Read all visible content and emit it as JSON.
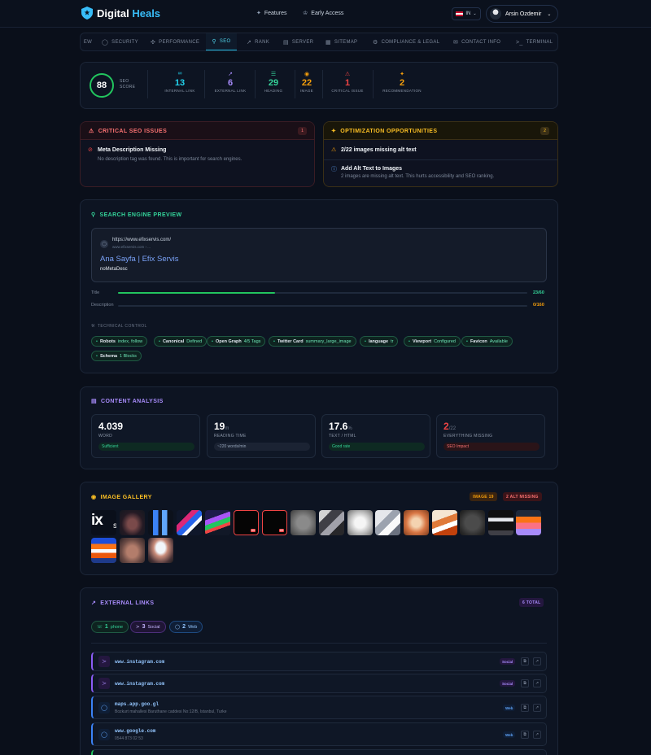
{
  "brand": {
    "name_a": "Digital ",
    "name_b": "Heals"
  },
  "nav": {
    "features": "Features",
    "early_access": "Early Access"
  },
  "lang": "IN",
  "user": {
    "name": "Arsin Ozdemir"
  },
  "tabs": [
    {
      "label": "EW",
      "icon": "overview-icon"
    },
    {
      "label": "SECURITY",
      "icon": "shield-icon"
    },
    {
      "label": "PERFORMANCE",
      "icon": "gauge-icon"
    },
    {
      "label": "SEO",
      "icon": "search-icon"
    },
    {
      "label": "RANK",
      "icon": "chart-icon"
    },
    {
      "label": "SERVER",
      "icon": "server-icon"
    },
    {
      "label": "SITEMAP",
      "icon": "sitemap-icon"
    },
    {
      "label": "COMPLIANCE & LEGAL",
      "icon": "scale-icon"
    },
    {
      "label": "CONTACT INFO",
      "icon": "mail-icon"
    },
    {
      "label": "TERMINAL",
      "icon": "terminal-icon"
    }
  ],
  "score": {
    "value": "88",
    "label_a": "SEO",
    "label_b": "SCORE",
    "color": "#22c55e"
  },
  "stats": [
    {
      "value": "13",
      "label": "INTERNAL LINK",
      "color": "#22d3ee",
      "icon": "link-icon"
    },
    {
      "value": "6",
      "label": "EXTERNAL LINK",
      "color": "#a78bfa",
      "icon": "external-link-icon"
    },
    {
      "value": "29",
      "label": "HEADING",
      "color": "#34d399",
      "icon": "layers-icon"
    },
    {
      "value": "22",
      "label": "IMAGE",
      "color": "#f59e0b",
      "icon": "eye-icon"
    },
    {
      "value": "1",
      "label": "CRITICAL ISSUE",
      "color": "#ef4444",
      "icon": "alert-icon"
    },
    {
      "value": "2",
      "label": "RECOMMENDATION",
      "color": "#f59e0b",
      "icon": "bolt-icon"
    }
  ],
  "critical": {
    "title": "CRITICAL SEO ISSUES",
    "count": "1",
    "items": [
      {
        "title": "Meta Description Missing",
        "desc": "No description tag was found. This is important for search engines."
      }
    ]
  },
  "opportunities": {
    "title": "OPTIMIZATION OPPORTUNITIES",
    "count": "2",
    "items": [
      {
        "title": "2/22 images missing alt text",
        "desc": ""
      },
      {
        "title": "Add Alt Text to Images",
        "desc": "2 images are missing alt text. This hurts accessibility and SEO ranking."
      }
    ]
  },
  "serp": {
    "title": "SEARCH ENGINE PREVIEW",
    "url": "https://www.efixservis.com/",
    "url_sub": "www.efixservis.com › ...",
    "page_title": "Ana Sayfa | Efix Servis",
    "desc": "noMetaDesc",
    "title_label": "Title",
    "title_value": "23/60",
    "title_ratio": 0.383,
    "desc_label": "Description",
    "desc_value": "0/160",
    "desc_ratio": 0
  },
  "technical": {
    "title": "TECHNICAL CONTROL",
    "chips": [
      {
        "key": "Robots",
        "value": "index, follow"
      },
      {
        "key": "Canonical",
        "value": "Defined"
      },
      {
        "key": "Open Graph",
        "value": "4/5 Tags"
      },
      {
        "key": "Twitter Card",
        "value": "summary_large_image"
      },
      {
        "key": "language",
        "value": "tr"
      },
      {
        "key": "Viewport",
        "value": "Configured"
      },
      {
        "key": "Favicon",
        "value": "Available"
      },
      {
        "key": "Schema",
        "value": "1 Blocks"
      }
    ]
  },
  "content": {
    "title": "CONTENT ANALYSIS",
    "boxes": [
      {
        "value": "4.039",
        "unit": "",
        "label": "WORD",
        "tag": "Sufficient",
        "tag_color": "#34d399",
        "tag_bg": "#0e2a22"
      },
      {
        "value": "19",
        "unit": "m",
        "label": "READING TIME",
        "tag": "~220 words/min",
        "tag_color": "#94a3b8",
        "tag_bg": "#1b2333"
      },
      {
        "value": "17.6",
        "unit": "%",
        "label": "TEXT / HTML",
        "tag": "Good rate",
        "tag_color": "#34d399",
        "tag_bg": "#0e2a22"
      },
      {
        "value": "2",
        "unit": "/22",
        "label": "EVERYTHING MISSING",
        "tag": "SEO Impact",
        "tag_color": "#f87171",
        "tag_bg": "#2a1418",
        "value_color": "#ef4444"
      }
    ]
  },
  "gallery": {
    "title": "IMAGE GALLERY",
    "image_badge": "IMAGE 19",
    "alt_badge": "2 ALT MISSING",
    "logo_text": "ix",
    "alt_text": "Alt"
  },
  "external": {
    "title": "EXTERNAL LINKS",
    "total": "6 TOTAL",
    "pills": [
      {
        "count": "1",
        "label": "phone"
      },
      {
        "count": "3",
        "label": "Social"
      },
      {
        "count": "2",
        "label": "Web"
      }
    ],
    "rows": [
      {
        "url": "www.instagram.com",
        "sub": "",
        "type": "Social"
      },
      {
        "url": "www.instagram.com",
        "sub": "",
        "type": "Social"
      },
      {
        "url": "maps.app.goo.gl",
        "sub": "Bozkurt mahallesi Baruthane caddesi No:12/B, Istanbul, Turke",
        "type": "Web"
      },
      {
        "url": "www.google.com",
        "sub": "0544 873 02 53",
        "type": "Web"
      }
    ]
  }
}
